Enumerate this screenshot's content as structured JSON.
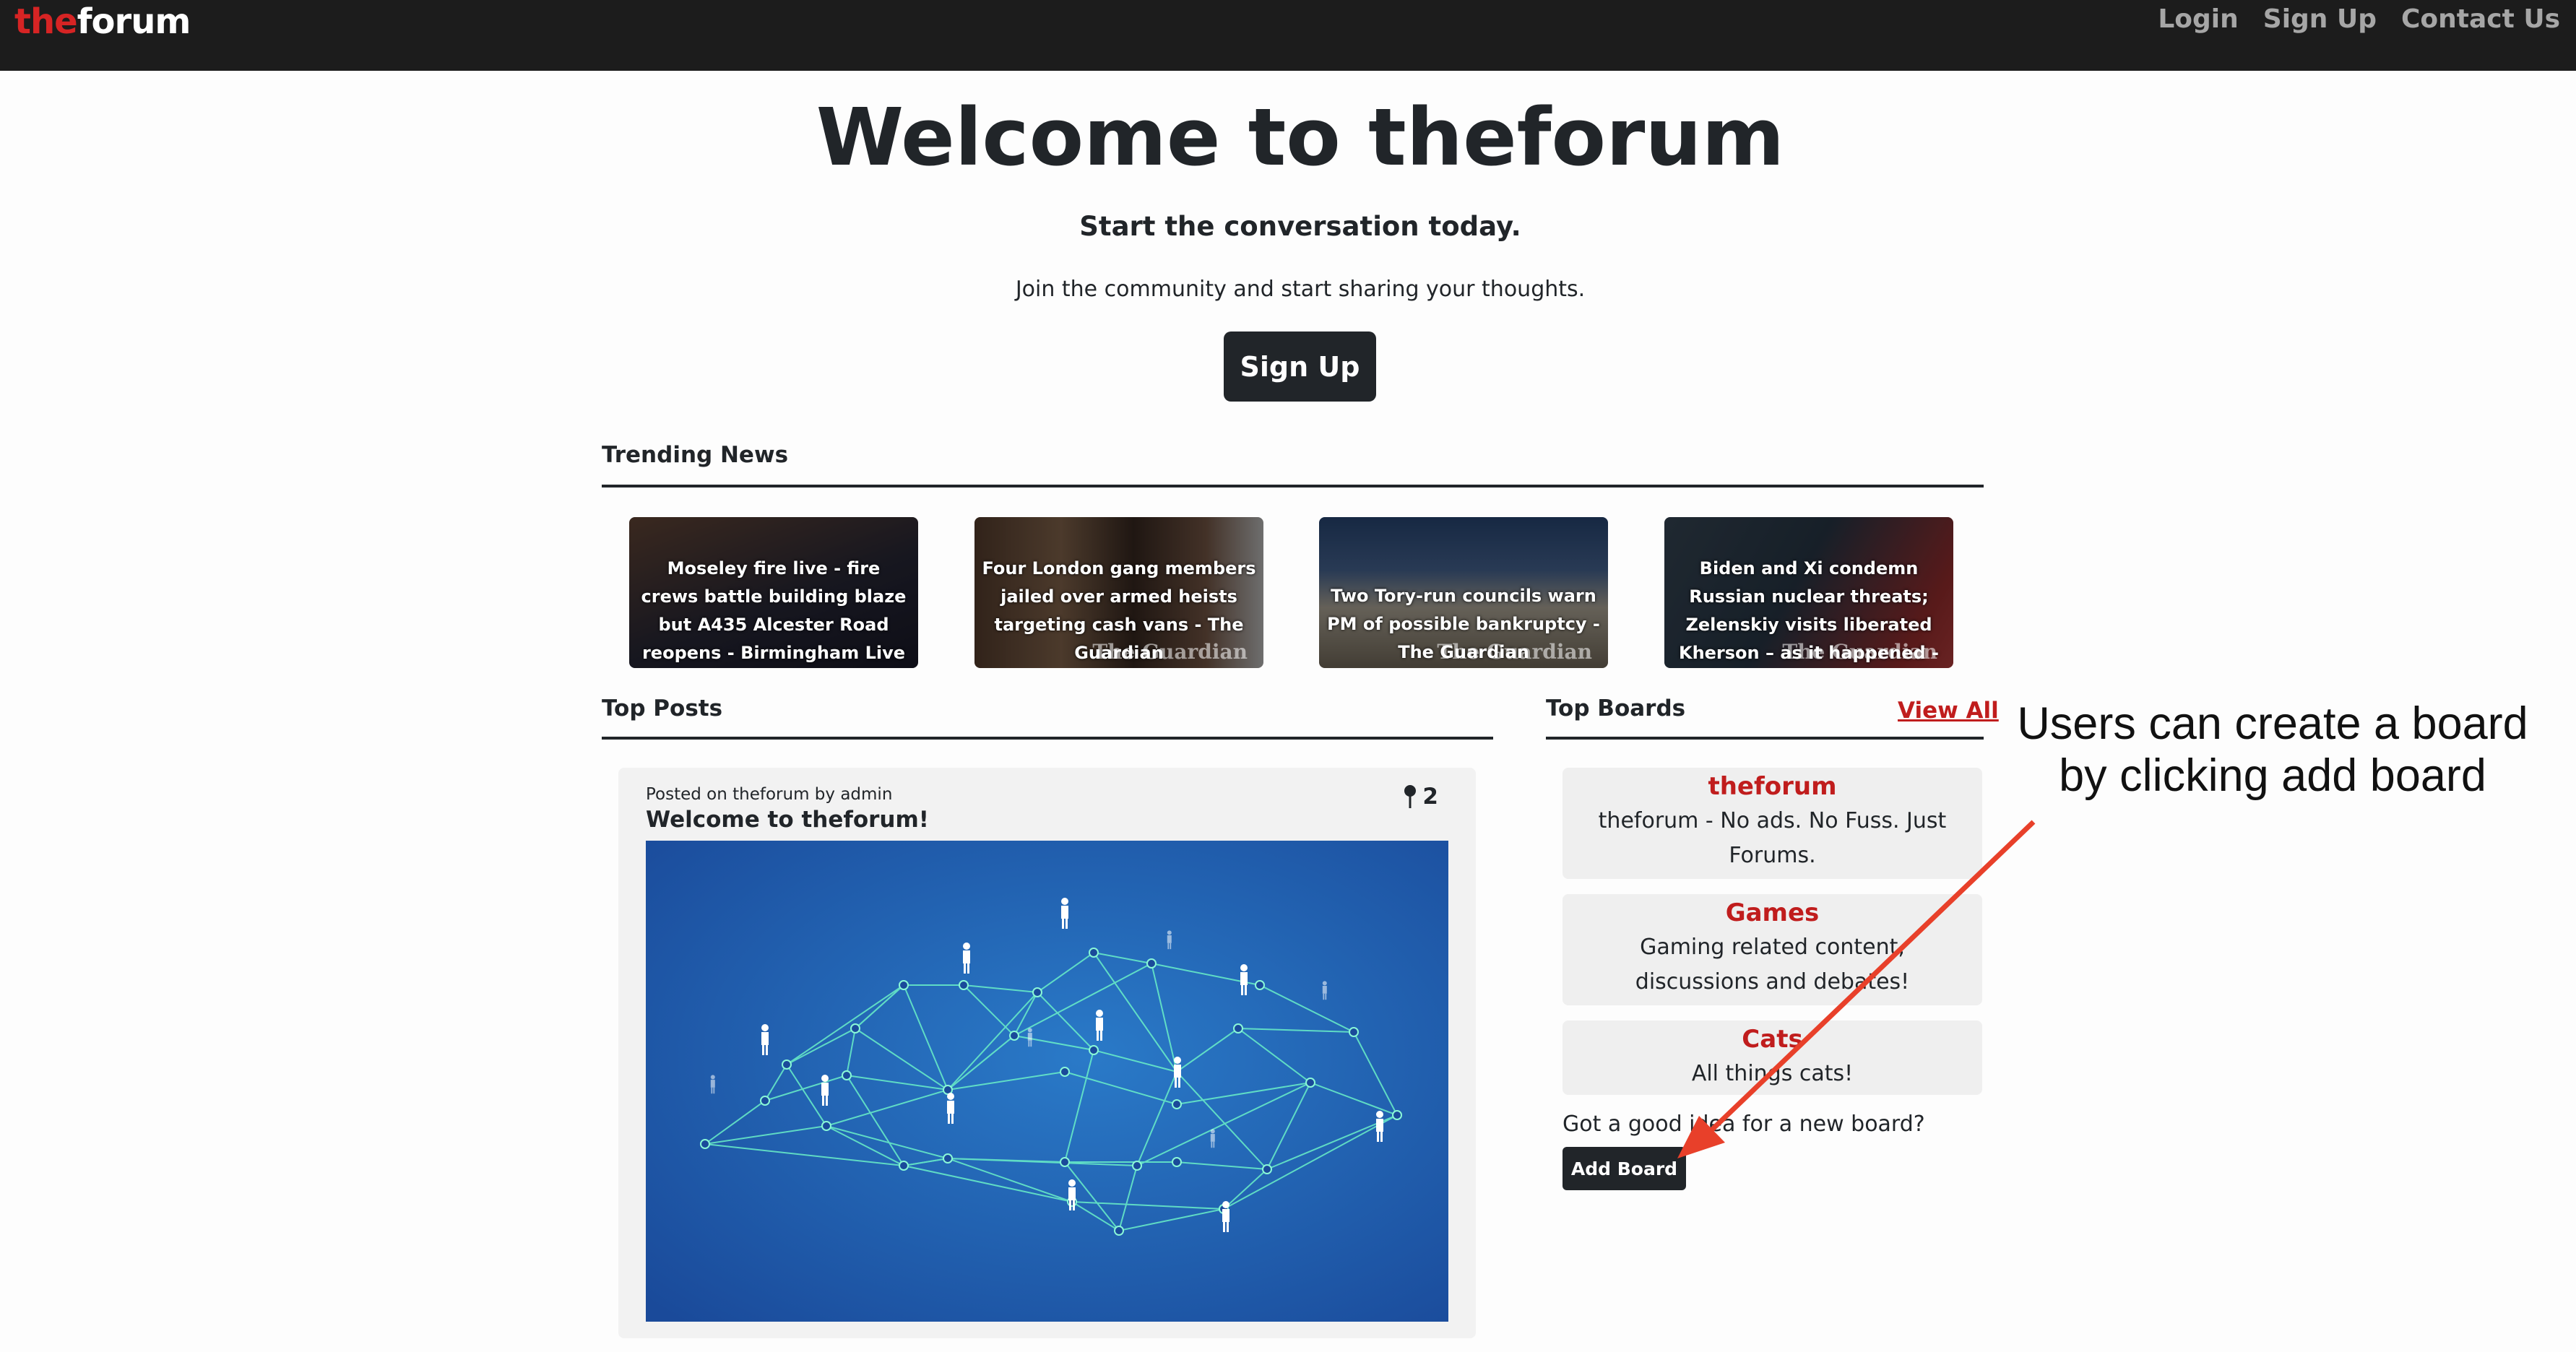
{
  "nav": {
    "brand_part1": "the",
    "brand_part2": "forum",
    "links": [
      "Login",
      "Sign Up",
      "Contact Us"
    ]
  },
  "hero": {
    "title": "Welcome to theforum",
    "subtitle": "Start the conversation today.",
    "description": "Join the community and start sharing your thoughts.",
    "button": "Sign Up"
  },
  "trending": {
    "heading": "Trending News",
    "items": [
      {
        "title": "Moseley fire live - fire crews battle building blaze but A435 Alcester Road reopens - Birmingham Live",
        "watermark": ""
      },
      {
        "title": "Four London gang members jailed over armed heists targeting cash vans - The Guardian",
        "watermark": "The Guardian"
      },
      {
        "title": "Two Tory-run councils warn PM of possible bankruptcy - The Guardian",
        "watermark": "The Guardian"
      },
      {
        "title": "Biden and Xi condemn Russian nuclear threats; Zelenskiy visits liberated Kherson – as it happened - The Guardian",
        "watermark": "The Guardian"
      }
    ]
  },
  "top_posts": {
    "heading": "Top Posts",
    "post": {
      "meta": "Posted on theforum by admin",
      "title": "Welcome to theforum!",
      "pin_count": "2",
      "image_icon": "network-people-image"
    }
  },
  "top_boards": {
    "heading": "Top Boards",
    "view_all": "View All",
    "boards": [
      {
        "name": "theforum",
        "description": "theforum - No ads. No Fuss. Just Forums."
      },
      {
        "name": "Games",
        "description": "Gaming related content, discussions and debates!"
      },
      {
        "name": "Cats",
        "description": "All things cats!"
      }
    ],
    "idea_text": "Got a good idea for a new board?",
    "add_button": "Add Board"
  },
  "annotation": {
    "text": "Users can create a board by clicking add board"
  },
  "colors": {
    "navbar": "#1c1c1c",
    "brand_red": "#d62424",
    "accent_red": "#c01d1d",
    "dark": "#212529",
    "arrow": "#e8402a"
  }
}
